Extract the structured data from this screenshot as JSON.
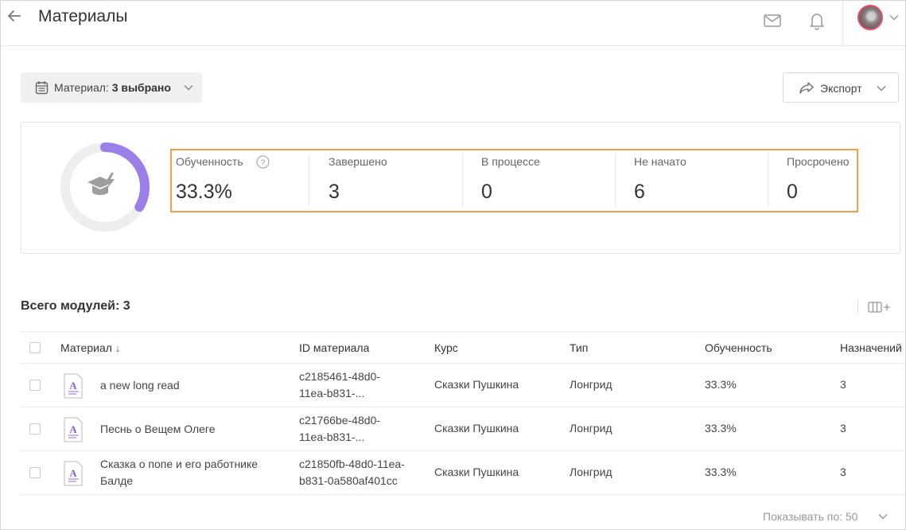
{
  "header": {
    "title": "Материалы"
  },
  "filter": {
    "label": "Материал:",
    "value": "3 выбрано"
  },
  "export": {
    "label": "Экспорт"
  },
  "summary": {
    "progress_percent": 33.3,
    "accent_color": "#9b7fe8",
    "stats": [
      {
        "label": "Обученность",
        "value": "33.3%"
      },
      {
        "label": "Завершено",
        "value": "3"
      },
      {
        "label": "В процессе",
        "value": "0"
      },
      {
        "label": "Не начато",
        "value": "6"
      },
      {
        "label": "Просрочено",
        "value": "0"
      }
    ]
  },
  "modules": {
    "title": "Всего модулей: 3"
  },
  "table": {
    "columns": {
      "material": "Материал",
      "sort_indicator": "↓",
      "id": "ID материала",
      "course": "Курс",
      "type": "Тип",
      "progress": "Обученность",
      "assignments": "Назначений"
    },
    "rows": [
      {
        "name_lines": [
          "a new long read"
        ],
        "id_lines": [
          "c2185461-48d0-",
          "11ea-b831-..."
        ],
        "course": "Сказки Пушкина",
        "type": "Лонгрид",
        "progress": "33.3%",
        "assignments": "3"
      },
      {
        "name_lines": [
          "Песнь о Вещем Олеге"
        ],
        "id_lines": [
          "c21766be-48d0-",
          "11ea-b831-..."
        ],
        "course": "Сказки Пушкина",
        "type": "Лонгрид",
        "progress": "33.3%",
        "assignments": "3"
      },
      {
        "name_lines": [
          "Сказка о попе и его работнике",
          "Балде"
        ],
        "id_lines": [
          "c21850fb-48d0-11ea-",
          "b831-0a580af401cc"
        ],
        "course": "Сказки Пушкина",
        "type": "Лонгрид",
        "progress": "33.3%",
        "assignments": "3"
      }
    ]
  },
  "pager": {
    "label": "Показывать по: 50"
  },
  "icons": {
    "back": "arrow-left-icon",
    "mail": "mail-icon",
    "bell": "bell-icon",
    "calendar": "calendar-icon",
    "share": "share-icon",
    "help": "help-icon",
    "columns": "columns-add-icon",
    "document": "longread-document-icon",
    "course": "graduation-cap-icon"
  }
}
